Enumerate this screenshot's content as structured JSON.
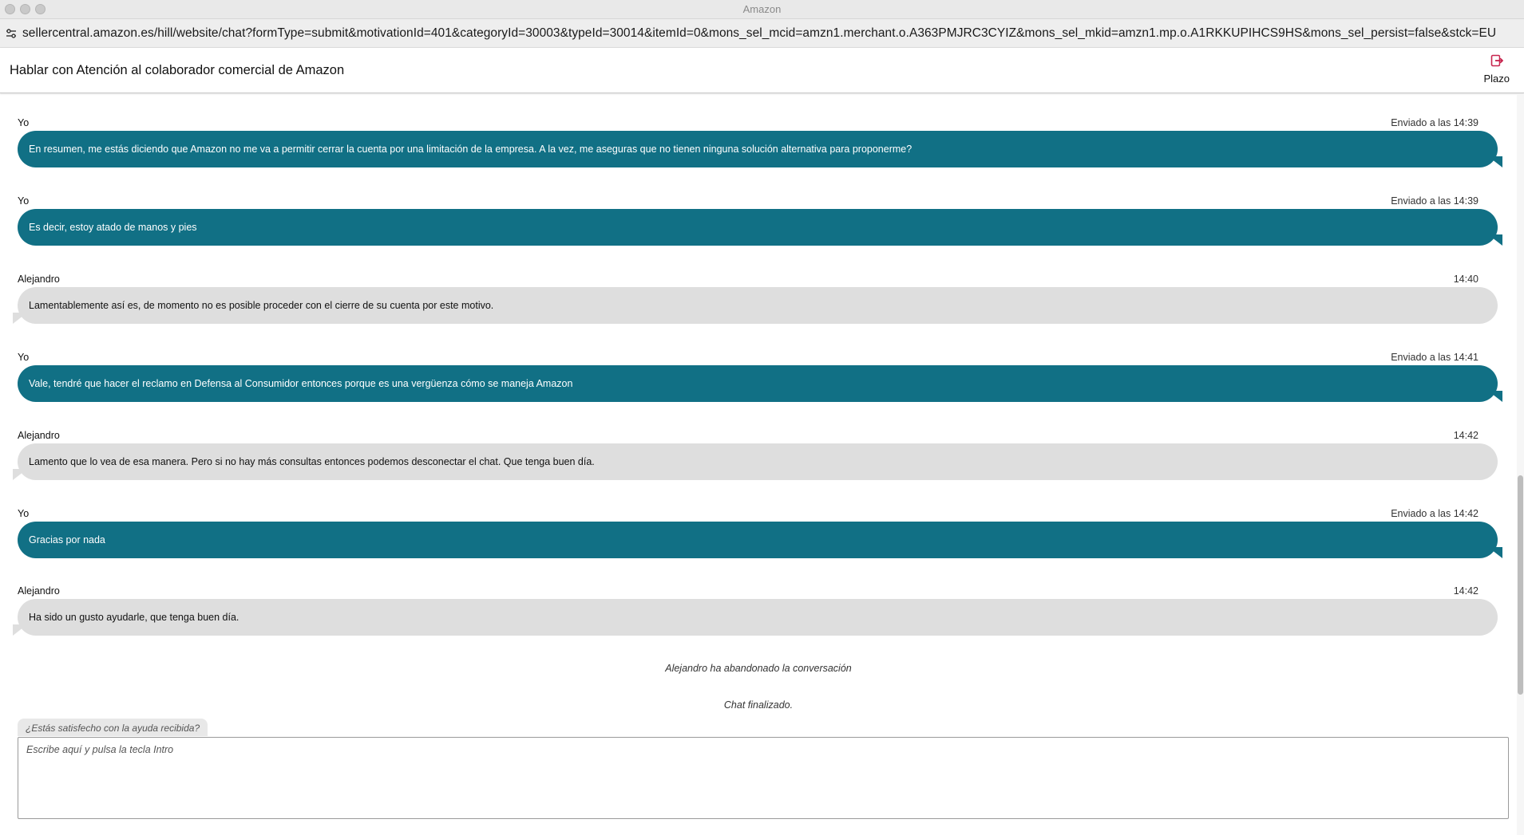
{
  "window": {
    "title": "Amazon"
  },
  "browser": {
    "url": "sellercentral.amazon.es/hill/website/chat?formType=submit&motivationId=401&categoryId=30003&typeId=30014&itemId=0&mons_sel_mcid=amzn1.merchant.o.A363PMJRC3CYIZ&mons_sel_mkid=amzn1.mp.o.A1RKKUPIHCS9HS&mons_sel_persist=false&stck=EU"
  },
  "header": {
    "title": "Hablar con Atención al colaborador comercial de Amazon",
    "deadline_label": "Plazo",
    "deadline_icon": "exit-icon",
    "accent_color": "#c7254e"
  },
  "messages": [
    {
      "sender": "Yo",
      "time": "Enviado a las 14:39",
      "text": "En resumen, me estás diciendo que Amazon no me va a permitir cerrar la cuenta por una limitación de la empresa. A la vez, me aseguras que no tienen ninguna solución alternativa para proponerme?",
      "direction": "out"
    },
    {
      "sender": "Yo",
      "time": "Enviado a las 14:39",
      "text": "Es decir, estoy atado de manos y pies",
      "direction": "out"
    },
    {
      "sender": "Alejandro",
      "time": "14:40",
      "text": "Lamentablemente así es, de momento no es posible proceder con el cierre de su cuenta por este motivo.",
      "direction": "in"
    },
    {
      "sender": "Yo",
      "time": "Enviado a las 14:41",
      "text": "Vale, tendré que hacer el reclamo en Defensa al Consumidor entonces porque es una vergüenza cómo se maneja Amazon",
      "direction": "out"
    },
    {
      "sender": "Alejandro",
      "time": "14:42",
      "text": "Lamento que lo vea de esa manera. Pero si no hay más consultas entonces podemos desconectar el chat. Que tenga buen día.",
      "direction": "in"
    },
    {
      "sender": "Yo",
      "time": "Enviado a las 14:42",
      "text": "Gracias por nada",
      "direction": "out"
    },
    {
      "sender": "Alejandro",
      "time": "14:42",
      "text": "Ha sido un gusto ayudarle, que tenga buen día.",
      "direction": "in"
    }
  ],
  "system": {
    "agent_left": "Alejandro ha abandonado la conversación",
    "chat_ended": "Chat finalizado."
  },
  "satisfaction": {
    "question": "¿Estás satisfecho con la ayuda recibida?"
  },
  "input": {
    "placeholder": "Escribe aquí y pulsa la tecla Intro",
    "value": ""
  },
  "colors": {
    "outgoing_bubble": "#117085",
    "incoming_bubble": "#dedede"
  }
}
